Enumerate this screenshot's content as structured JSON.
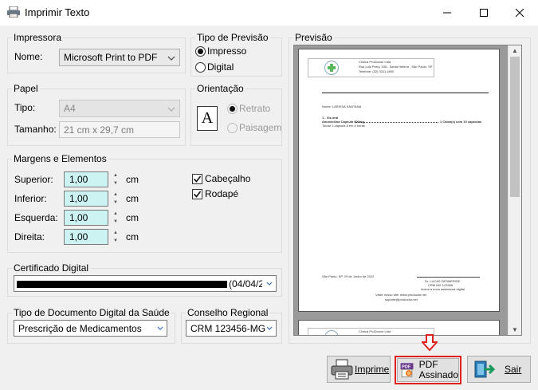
{
  "window": {
    "title": "Imprimir Texto"
  },
  "printer": {
    "legend": "Impressora",
    "name_label": "Nome:",
    "name_value": "Microsoft Print to PDF"
  },
  "preview_type": {
    "legend": "Tipo de Previsão",
    "options": [
      "Impresso",
      "Digital"
    ],
    "selected": "Impresso"
  },
  "paper": {
    "legend": "Papel",
    "type_label": "Tipo:",
    "type_value": "A4",
    "size_label": "Tamanho:",
    "size_value": "21 cm x 29,7 cm"
  },
  "orientation": {
    "legend": "Orientação",
    "icon_letter": "A",
    "options": [
      "Retrato",
      "Paisagem"
    ],
    "selected": "Retrato"
  },
  "margins": {
    "legend": "Margens e Elementos",
    "unit": "cm",
    "fields": [
      {
        "label": "Superior:",
        "value": "1,00"
      },
      {
        "label": "Inferior:",
        "value": "1,00"
      },
      {
        "label": "Esquerda:",
        "value": "1,00"
      },
      {
        "label": "Direita:",
        "value": "1,00"
      }
    ],
    "header_label": "Cabeçalho",
    "footer_label": "Rodapé"
  },
  "certificate": {
    "legend": "Certificado Digital",
    "value_suffix": "(04/04/2"
  },
  "doc_type": {
    "legend": "Tipo de Documento Digital da Saúde",
    "value": "Prescrição de Medicamentos"
  },
  "council": {
    "legend": "Conselho Regional",
    "value": "CRM 123456-MG"
  },
  "preview": {
    "legend": "Previsão",
    "clinic_name": "Clínica ProDoctor Ltda",
    "clinic_address": "Rua Luiz Perry, 335 - Santa Helena - São Paulo, SP",
    "clinic_phone": "Telefone: (32) 3311-4500",
    "patient_line": "Nome: LARISSA SANTANA",
    "section": "1 - Via oral",
    "med_line": "Amoxicilina Cápsula 500mg",
    "med_qty": "1 Caixa(s) com 10 cápsulas",
    "med_instr": "Tomar 1 cápsula 8 em 8 horas.",
    "date_line": "São Paulo, SP, 29 de Junho de 2022",
    "doctor_name": "Dr. LUCAS DESMERISE",
    "doctor_crm": "CRM MG 123456",
    "doctor_note": "Inclua a nova assinatura digital",
    "footer_site": "Visite nosso site: www.prodoctor.net",
    "footer_mail": "suporte@prodoctor.net",
    "next_clinic": "Clínica ProDoctor Ltda"
  },
  "buttons": {
    "print": "Imprime",
    "pdf_line1": "PDF",
    "pdf_line2": "Assinado",
    "exit": "Sair"
  },
  "colors": {
    "highlight_red": "#e0201c",
    "accent_cyan": "#ccf2f2"
  }
}
